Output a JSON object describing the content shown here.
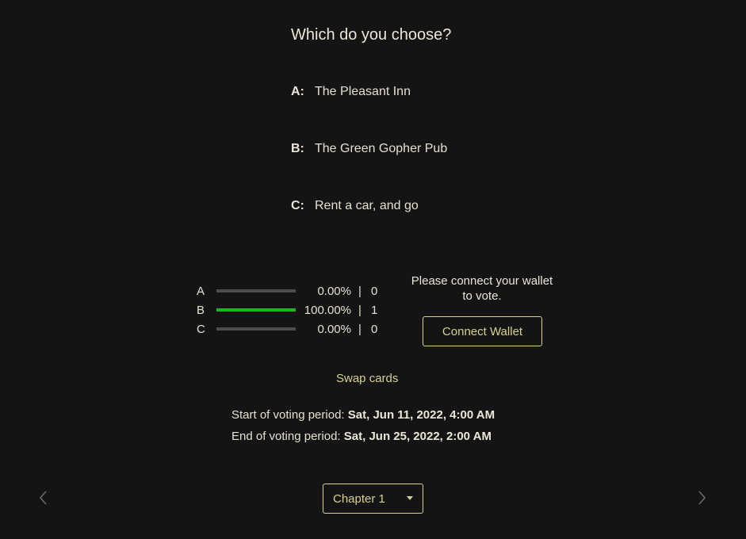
{
  "question": "Which do you choose?",
  "options": [
    {
      "key": "A:",
      "text": "The Pleasant Inn"
    },
    {
      "key": "B:",
      "text": "The Green Gopher Pub"
    },
    {
      "key": "C:",
      "text": "Rent a car, and go"
    }
  ],
  "results": [
    {
      "letter": "A",
      "fraction": 0.0,
      "percent": "0.00%",
      "sep": "|",
      "count": "0",
      "color": "#4d4d4d"
    },
    {
      "letter": "B",
      "fraction": 1.0,
      "percent": "100.00%",
      "sep": "|",
      "count": "1",
      "color": "#22b41f"
    },
    {
      "letter": "C",
      "fraction": 0.0,
      "percent": "0.00%",
      "sep": "|",
      "count": "0",
      "color": "#4d4d4d"
    }
  ],
  "connect": {
    "message": "Please connect your wallet to vote.",
    "button_label": "Connect Wallet"
  },
  "swap_label": "Swap cards",
  "voting": {
    "start_label": "Start of voting period:",
    "start_value": "Sat, Jun 11, 2022, 4:00 AM",
    "end_label": "End of voting period:",
    "end_value": "Sat, Jun 25, 2022, 2:00 AM"
  },
  "chapter_select": {
    "selected": "Chapter 1"
  },
  "nav": {
    "prev_icon": "chevron-left-icon",
    "next_icon": "chevron-right-icon"
  },
  "colors": {
    "accent": "#d8d08e",
    "background": "#141414",
    "win_bar": "#22b41f",
    "track": "#4d4d4d"
  }
}
